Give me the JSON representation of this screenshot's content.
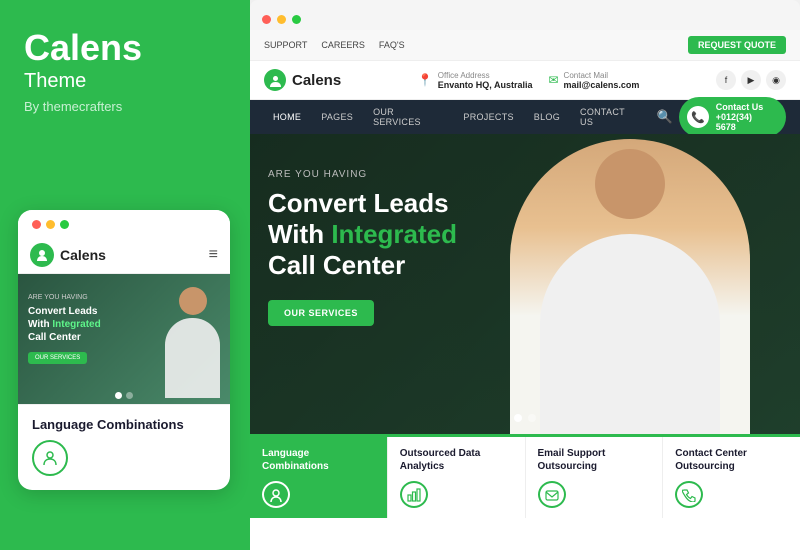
{
  "brand": {
    "title": "Calens",
    "sub": "Theme",
    "by": "By themecrafters",
    "logo_text": "Calens"
  },
  "mobile": {
    "logo_text": "Calens",
    "hero_subtitle": "ARE YOU HAVING",
    "hero_title_line1": "Convert Leads",
    "hero_title_line2": "With",
    "hero_title_green": "Integrated",
    "hero_title_line3": "Call Center",
    "cta_label": "OUR SERVICES",
    "service_title": "Language Combinations"
  },
  "topbar": {
    "link1": "SUPPORT",
    "link2": "CAREERS",
    "link3": "FAQ'S",
    "request_btn": "REQUEST QUOTE"
  },
  "navbar": {
    "logo_text": "Calens",
    "office_label": "Office Address",
    "office_value": "Envanto HQ, Australia",
    "mail_label": "Contact Mail",
    "mail_value": "mail@calens.com"
  },
  "mainnav": {
    "items": [
      {
        "label": "HOME",
        "active": true
      },
      {
        "label": "PAGES",
        "active": false
      },
      {
        "label": "OUR SERVICES",
        "active": false
      },
      {
        "label": "PROJECTS",
        "active": false
      },
      {
        "label": "BLOG",
        "active": false
      },
      {
        "label": "CONTACT US",
        "active": false
      }
    ],
    "contact_btn": "Contact Us",
    "contact_phone": "+012(34) 5678"
  },
  "hero": {
    "subtitle": "ARE YOU HAVING",
    "title_line1": "Convert Leads",
    "title_line2": "With",
    "title_green": "Integrated",
    "title_line3": "Call Center",
    "cta_label": "OUR SERVICES"
  },
  "services": [
    {
      "title": "Language\nCombinations",
      "icon": "🌐"
    },
    {
      "title": "Outsourced Data\nAnalytics",
      "icon": "📊"
    },
    {
      "title": "Email Support\nOutsourcing",
      "icon": "✉️"
    },
    {
      "title": "Contact Center\nOutsourcing",
      "icon": "📞"
    }
  ],
  "colors": {
    "primary": "#2dba4e",
    "dark": "#1e2a38",
    "white": "#ffffff"
  }
}
